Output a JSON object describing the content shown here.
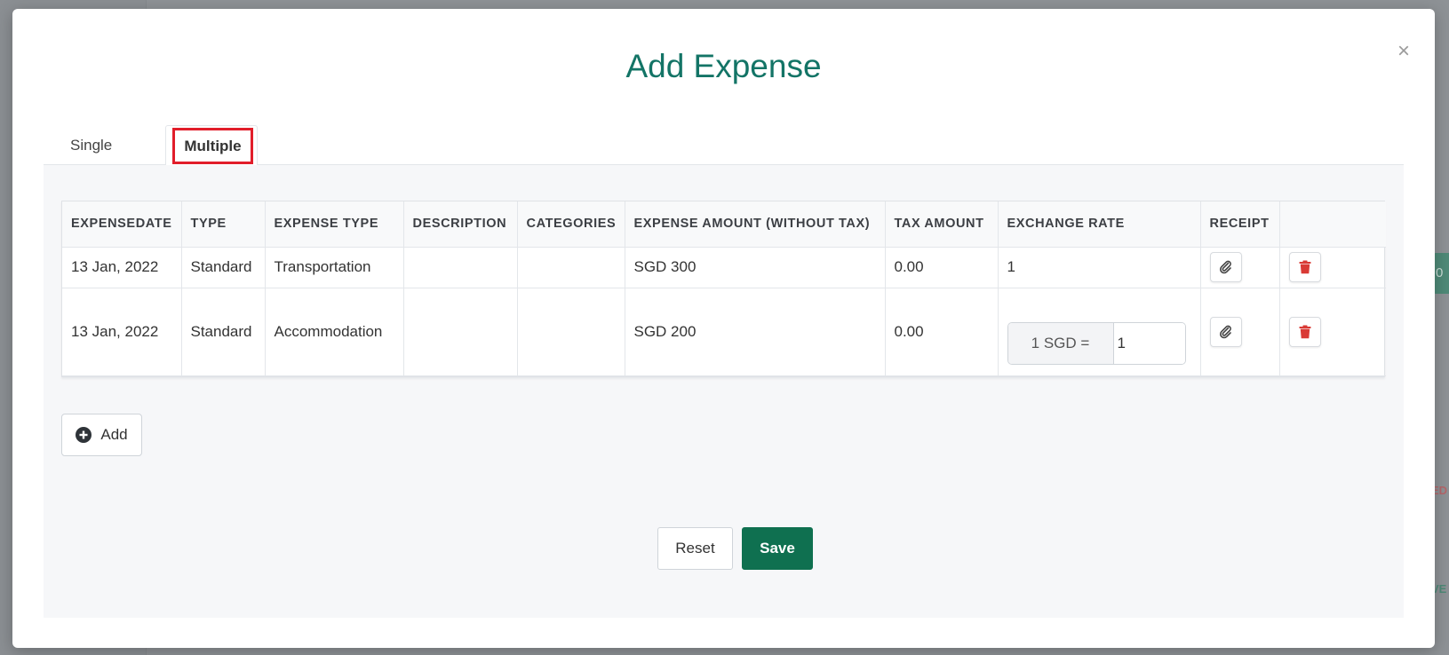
{
  "modal": {
    "title": "Add Expense",
    "close_label": "×"
  },
  "tabs": [
    {
      "label": "Single",
      "active": false
    },
    {
      "label": "Multiple",
      "active": true
    }
  ],
  "table": {
    "headers": [
      "EXPENSEDATE",
      "TYPE",
      "EXPENSE TYPE",
      "DESCRIPTION",
      "CATEGORIES",
      "EXPENSE AMOUNT (WITHOUT TAX)",
      "TAX AMOUNT",
      "EXCHANGE RATE",
      "RECEIPT",
      ""
    ],
    "rows": [
      {
        "date": "13 Jan, 2022",
        "type": "Standard",
        "expense_type": "Transportation",
        "description": "",
        "categories": "",
        "amount": "SGD 300",
        "tax": "0.00",
        "exchange_rate": "1"
      },
      {
        "date": "13 Jan, 2022",
        "type": "Standard",
        "expense_type": "Accommodation",
        "description": "",
        "categories": "",
        "amount": "SGD 200",
        "tax": "0.00",
        "exchange_prefix": "1 SGD =",
        "exchange_value": "1"
      }
    ]
  },
  "buttons": {
    "add": "Add",
    "reset": "Reset",
    "save": "Save"
  },
  "colors": {
    "title": "#137466",
    "save": "#0f7050",
    "delete_icon": "#d93a35",
    "tab_highlight": "#e11d2a"
  }
}
